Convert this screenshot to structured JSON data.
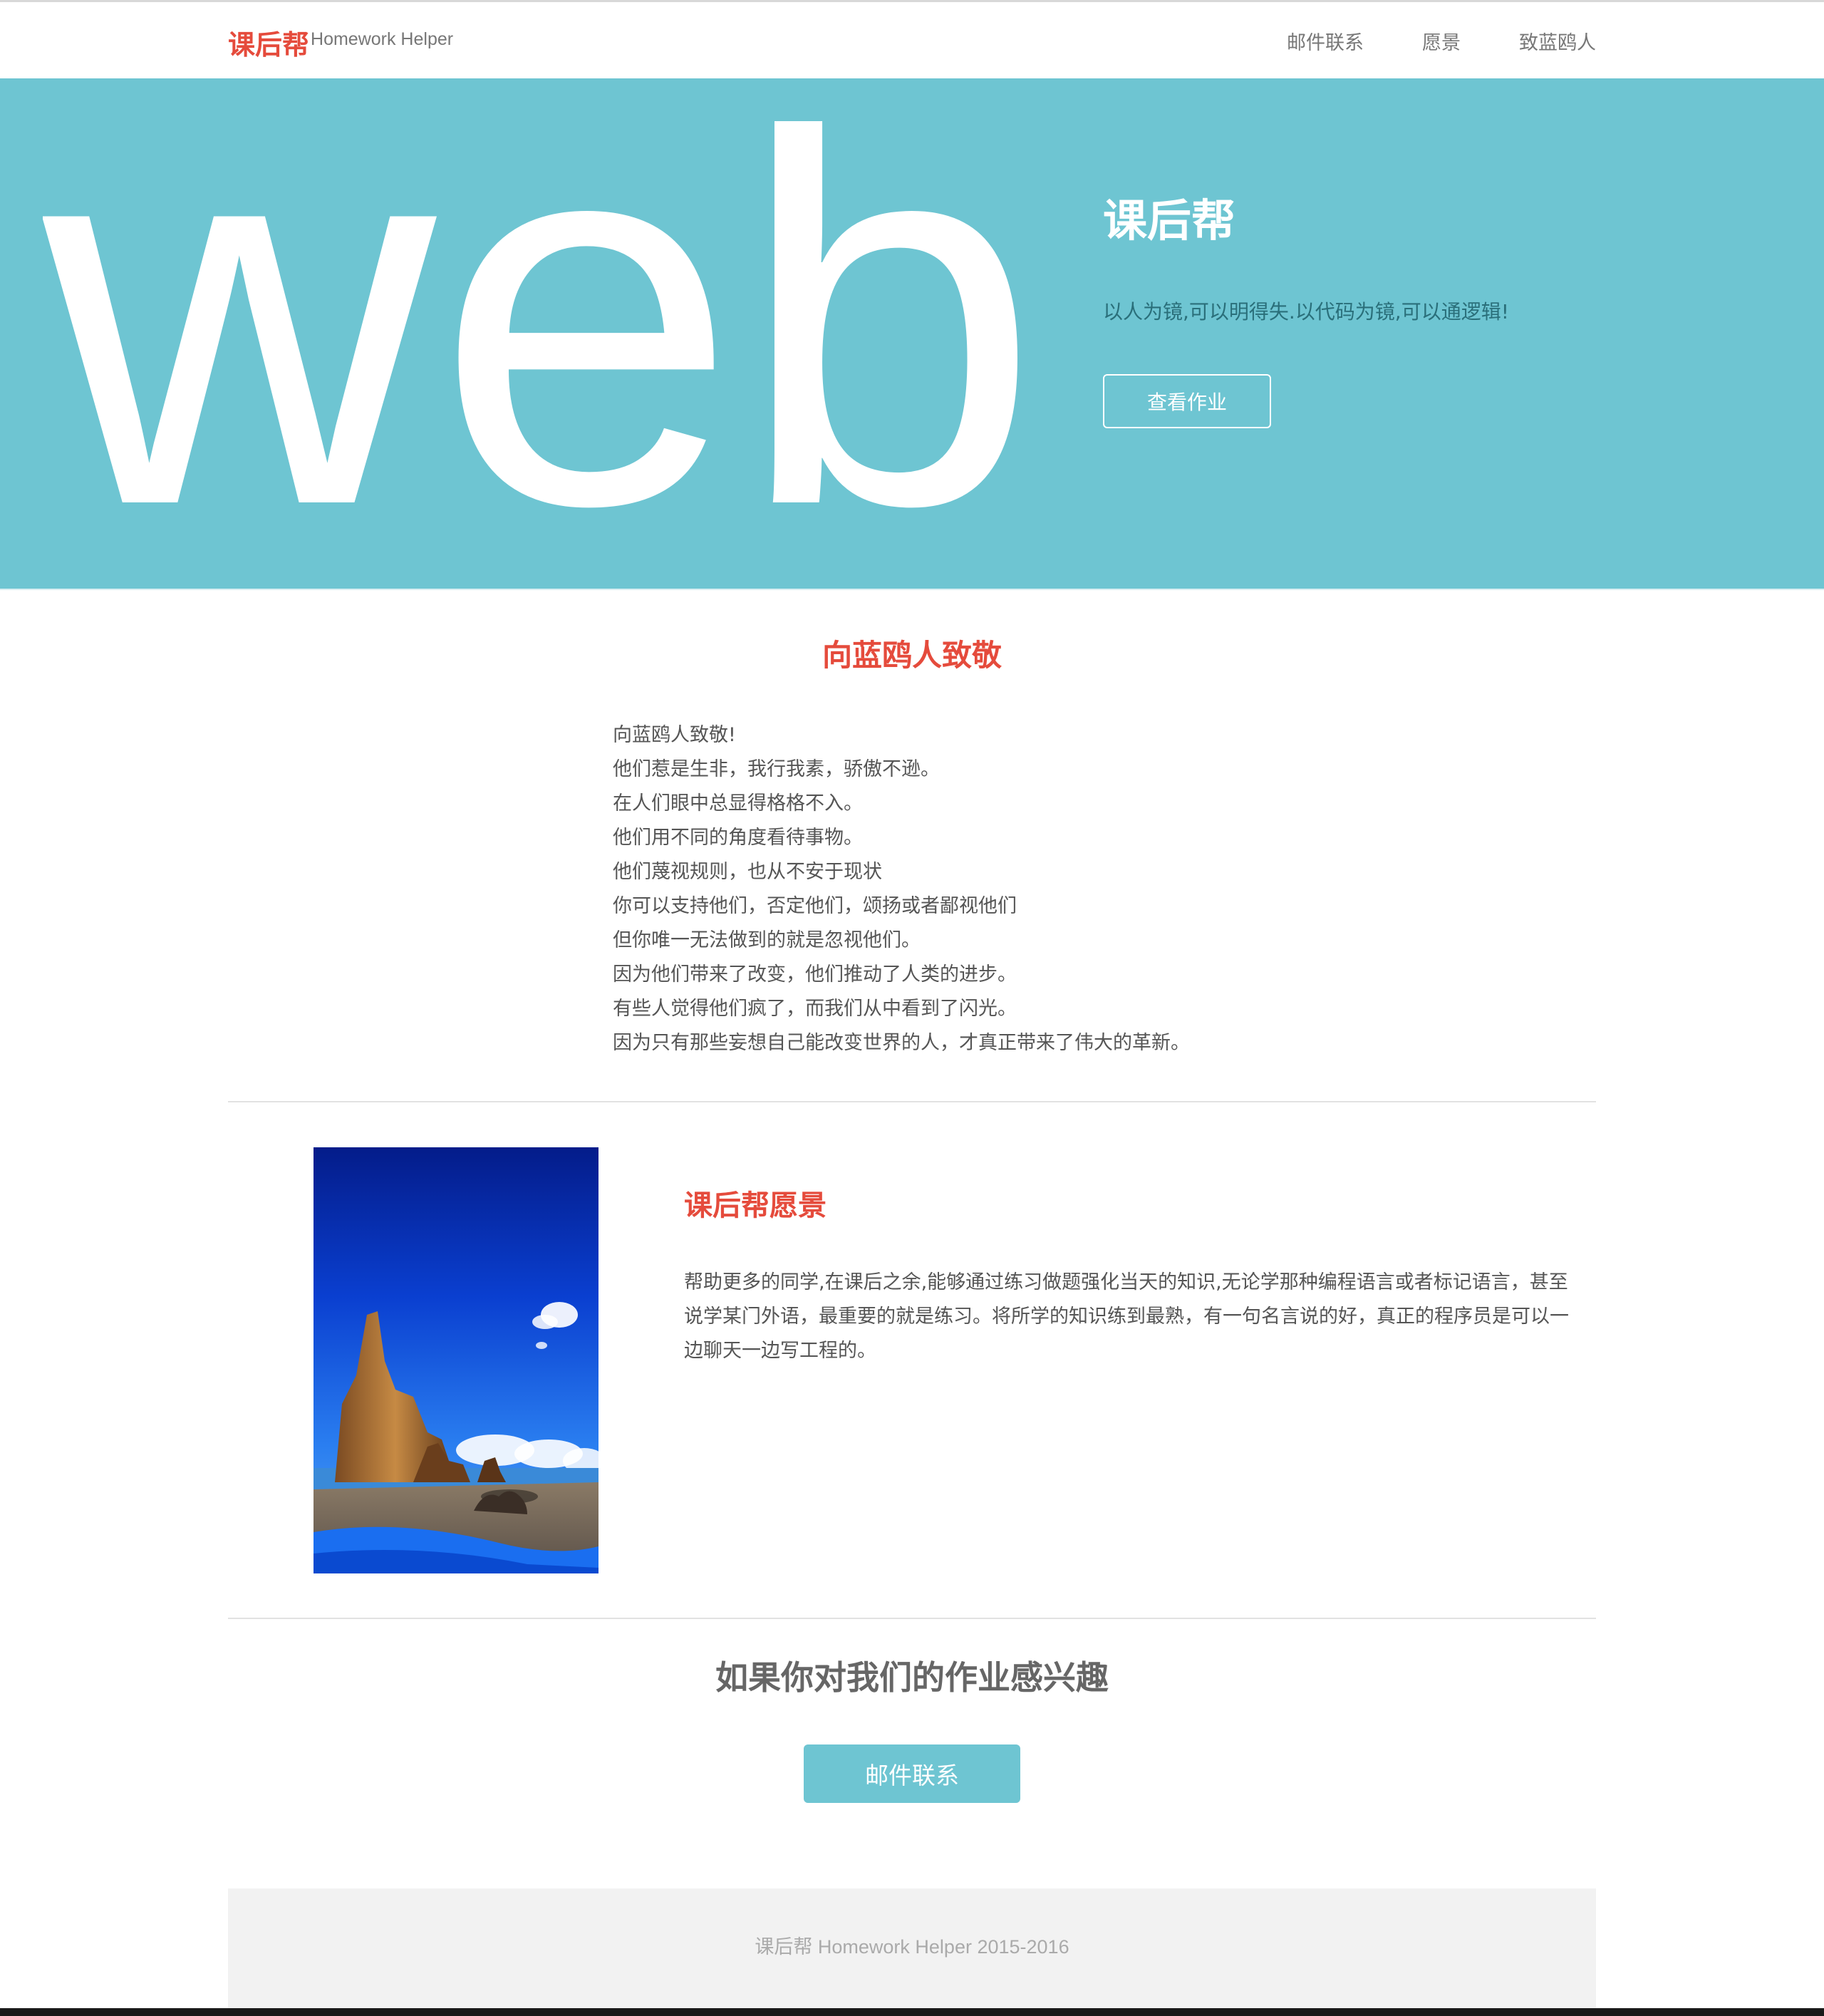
{
  "navbar": {
    "brand_cn": "课后帮",
    "brand_en": "Homework Helper",
    "links": [
      "邮件联系",
      "愿景",
      "致蓝鸥人"
    ]
  },
  "hero": {
    "big_text": "web",
    "title": "课后帮",
    "subtitle": "以人为镜,可以明得失.以代码为镜,可以通逻辑!",
    "button_label": "查看作业"
  },
  "tribute": {
    "title": "向蓝鸥人致敬",
    "lines": [
      "向蓝鸥人致敬!",
      "他们惹是生非，我行我素，骄傲不逊。",
      "在人们眼中总显得格格不入。",
      "他们用不同的角度看待事物。",
      "他们蔑视规则，也从不安于现状",
      "你可以支持他们，否定他们，颂扬或者鄙视他们",
      "但你唯一无法做到的就是忽视他们。",
      "因为他们带来了改变，他们推动了人类的进步。",
      "有些人觉得他们疯了，而我们从中看到了闪光。",
      "因为只有那些妄想自己能改变世界的人，才真正带来了伟大的革新。"
    ]
  },
  "vision": {
    "title": "课后帮愿景",
    "text": "帮助更多的同学,在课后之余,能够通过练习做题强化当天的知识,无论学那种编程语言或者标记语言，甚至说学某门外语，最重要的就是练习。将所学的知识练到最熟，有一句名言说的好，真正的程序员是可以一边聊天一边写工程的。"
  },
  "cta": {
    "title": "如果你对我们的作业感兴趣",
    "button_label": "邮件联系"
  },
  "footer": {
    "text": "课后帮 Homework Helper 2015-2016"
  },
  "colors": {
    "accent": "#e54b3c",
    "hero_bg": "#6ec5d2",
    "footer_bg": "#f2f2f2"
  }
}
